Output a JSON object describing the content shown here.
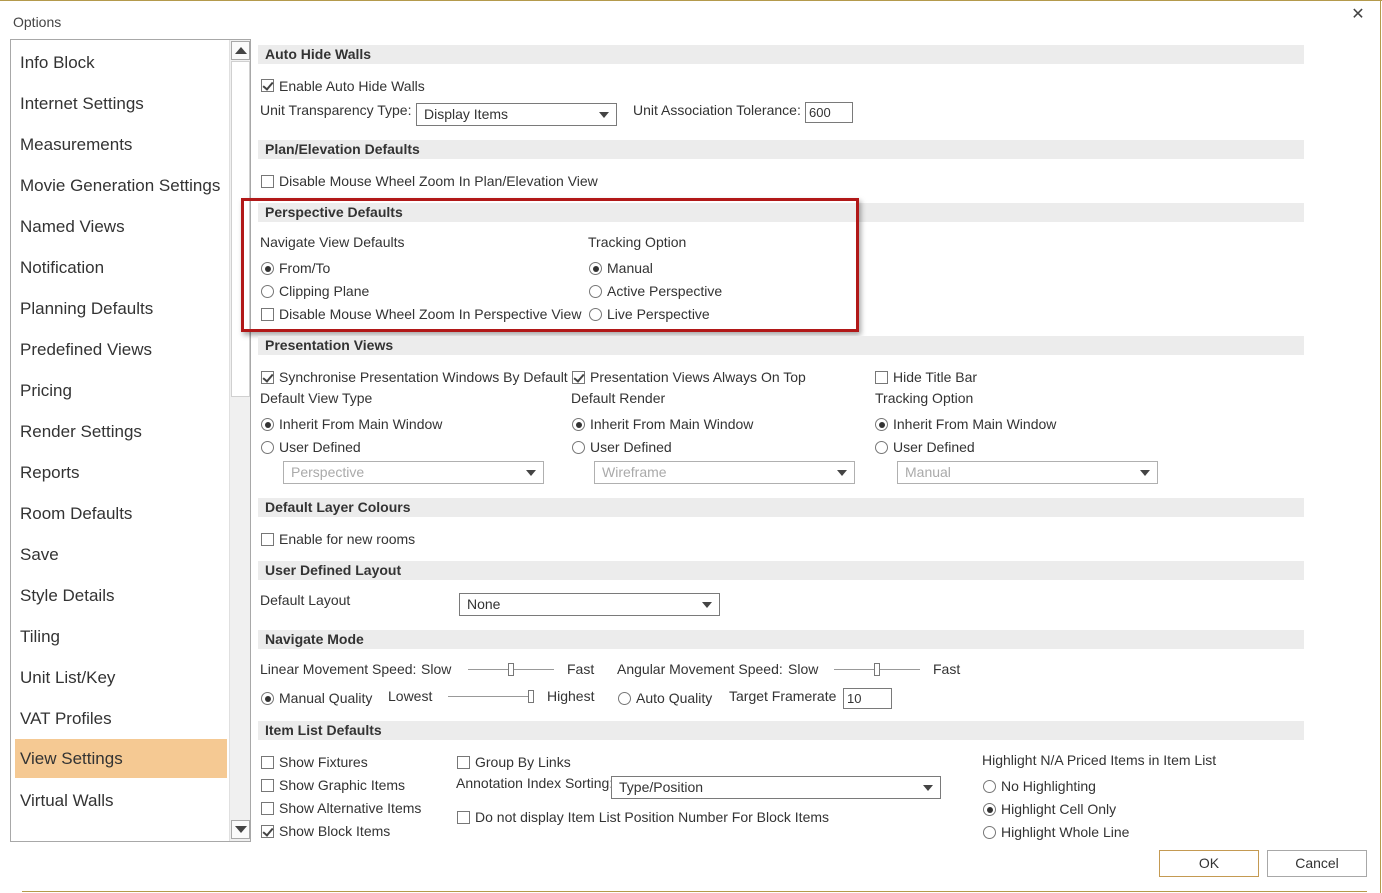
{
  "window": {
    "title": "Options",
    "close_glyph": "✕"
  },
  "sidebar": {
    "items": [
      "Info Block",
      "Internet Settings",
      "Measurements",
      "Movie Generation Settings",
      "Named Views",
      "Notification",
      "Planning Defaults",
      "Predefined Views",
      "Pricing",
      "Render Settings",
      "Reports",
      "Room Defaults",
      "Save",
      "Style Details",
      "Tiling",
      "Unit List/Key",
      "VAT Profiles",
      "View Settings",
      "Virtual Walls"
    ],
    "active": "View Settings",
    "active_color": "#f5c993"
  },
  "auto_hide": {
    "title": "Auto Hide Walls",
    "enable": {
      "label": "Enable Auto Hide Walls",
      "checked": true
    },
    "transparency_label": "Unit Transparency Type:",
    "transparency_value": "Display Items",
    "tolerance_label": "Unit Association Tolerance:",
    "tolerance_value": "600"
  },
  "plan_elevation": {
    "title": "Plan/Elevation Defaults",
    "disable_zoom": {
      "label": "Disable Mouse Wheel Zoom In Plan/Elevation View",
      "checked": false
    }
  },
  "perspective": {
    "title": "Perspective Defaults",
    "navigate_title": "Navigate View Defaults",
    "from_to": "From/To",
    "clipping": "Clipping Plane",
    "disable_zoom": "Disable Mouse Wheel Zoom In Perspective View",
    "tracking_title": "Tracking Option",
    "manual": "Manual",
    "active": "Active Perspective",
    "live": "Live Perspective",
    "highlight_color": "#b11818"
  },
  "presentation": {
    "title": "Presentation Views",
    "sync": "Synchronise Presentation Windows By Default",
    "on_top": "Presentation Views Always On Top",
    "hide_title": "Hide Title Bar",
    "view_type_title": "Default View Type",
    "render_title": "Default Render",
    "tracking_title": "Tracking Option",
    "inherit": "Inherit From Main Window",
    "user_defined": "User Defined",
    "view_type_value": "Perspective",
    "render_value": "Wireframe",
    "tracking_value": "Manual"
  },
  "layer_colours": {
    "title": "Default Layer Colours",
    "enable": "Enable for new rooms"
  },
  "user_layout": {
    "title": "User Defined Layout",
    "label": "Default Layout",
    "value": "None"
  },
  "navigate": {
    "title": "Navigate Mode",
    "linear_label": "Linear Movement Speed:",
    "angular_label": "Angular Movement Speed:",
    "slow": "Slow",
    "fast": "Fast",
    "linear_level": 0.5,
    "angular_level": 0.5,
    "manual_quality": "Manual Quality",
    "lowest": "Lowest",
    "highest": "Highest",
    "quality_level": 1.0,
    "auto_quality": "Auto Quality",
    "framerate_label": "Target Framerate",
    "framerate_value": "10"
  },
  "item_list": {
    "title": "Item List Defaults",
    "show_fixtures": "Show Fixtures",
    "show_graphic": "Show Graphic Items",
    "show_alternative": "Show Alternative Items",
    "show_block": "Show Block Items",
    "group_links": "Group By Links",
    "annotation_label": "Annotation Index Sorting:",
    "annotation_value": "Type/Position",
    "no_position": "Do not display Item List Position Number For Block Items",
    "highlight_title": "Highlight N/A Priced Items in Item List",
    "no_highlighting": "No Highlighting",
    "highlight_cell": "Highlight Cell Only",
    "highlight_line": "Highlight Whole Line"
  },
  "buttons": {
    "ok": "OK",
    "cancel": "Cancel",
    "ok_border": "#c49a52"
  }
}
